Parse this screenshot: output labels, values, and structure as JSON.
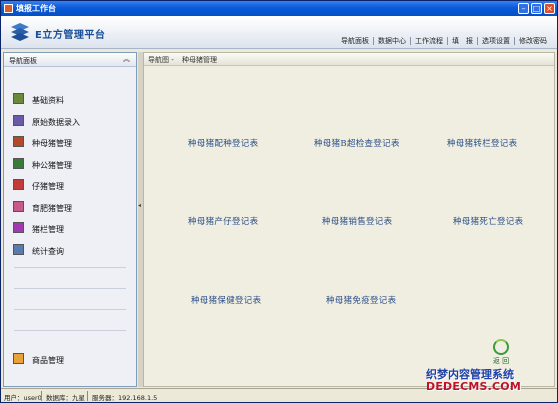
{
  "window": {
    "title": "填报工作台"
  },
  "banner": {
    "logo_text": "E立方管理平台"
  },
  "topnav": [
    "导航面板",
    "数据中心",
    "工作流程",
    "填　报",
    "选项设置",
    "修改密码"
  ],
  "sidebar": {
    "header": "导航面板",
    "items": [
      {
        "label": "基础资料",
        "color": "#6a8a3a"
      },
      {
        "label": "原始数据录入",
        "color": "#6a5aa8"
      },
      {
        "label": "种母猪管理",
        "color": "#b24a2a"
      },
      {
        "label": "种公猪管理",
        "color": "#3a7a3a"
      },
      {
        "label": "仔猪管理",
        "color": "#c23a3a"
      },
      {
        "label": "育肥猪管理",
        "color": "#c85a8a"
      },
      {
        "label": "猪栏管理",
        "color": "#a03ab0"
      },
      {
        "label": "统计查询",
        "color": "#5a7ab0"
      }
    ],
    "bottom_item": "商品管理"
  },
  "breadcrumb": {
    "root": "导航图 -",
    "current": "种母猪管理"
  },
  "links": [
    "种母猪配种登记表",
    "种母猪B超检查登记表",
    "种母猪转栏登记表",
    "种母猪产仔登记表",
    "种母猪销售登记表",
    "种母猪死亡登记表",
    "种母猪保健登记表",
    "种母猪免疫登记表"
  ],
  "return_label": "返 回",
  "status": {
    "user": "用户：user0",
    "db": "数据库：九星",
    "server": "服务器：192.168.1.5"
  },
  "watermark": {
    "line1": "织梦内容管理系统",
    "line2": "DEDECMS.COM"
  }
}
